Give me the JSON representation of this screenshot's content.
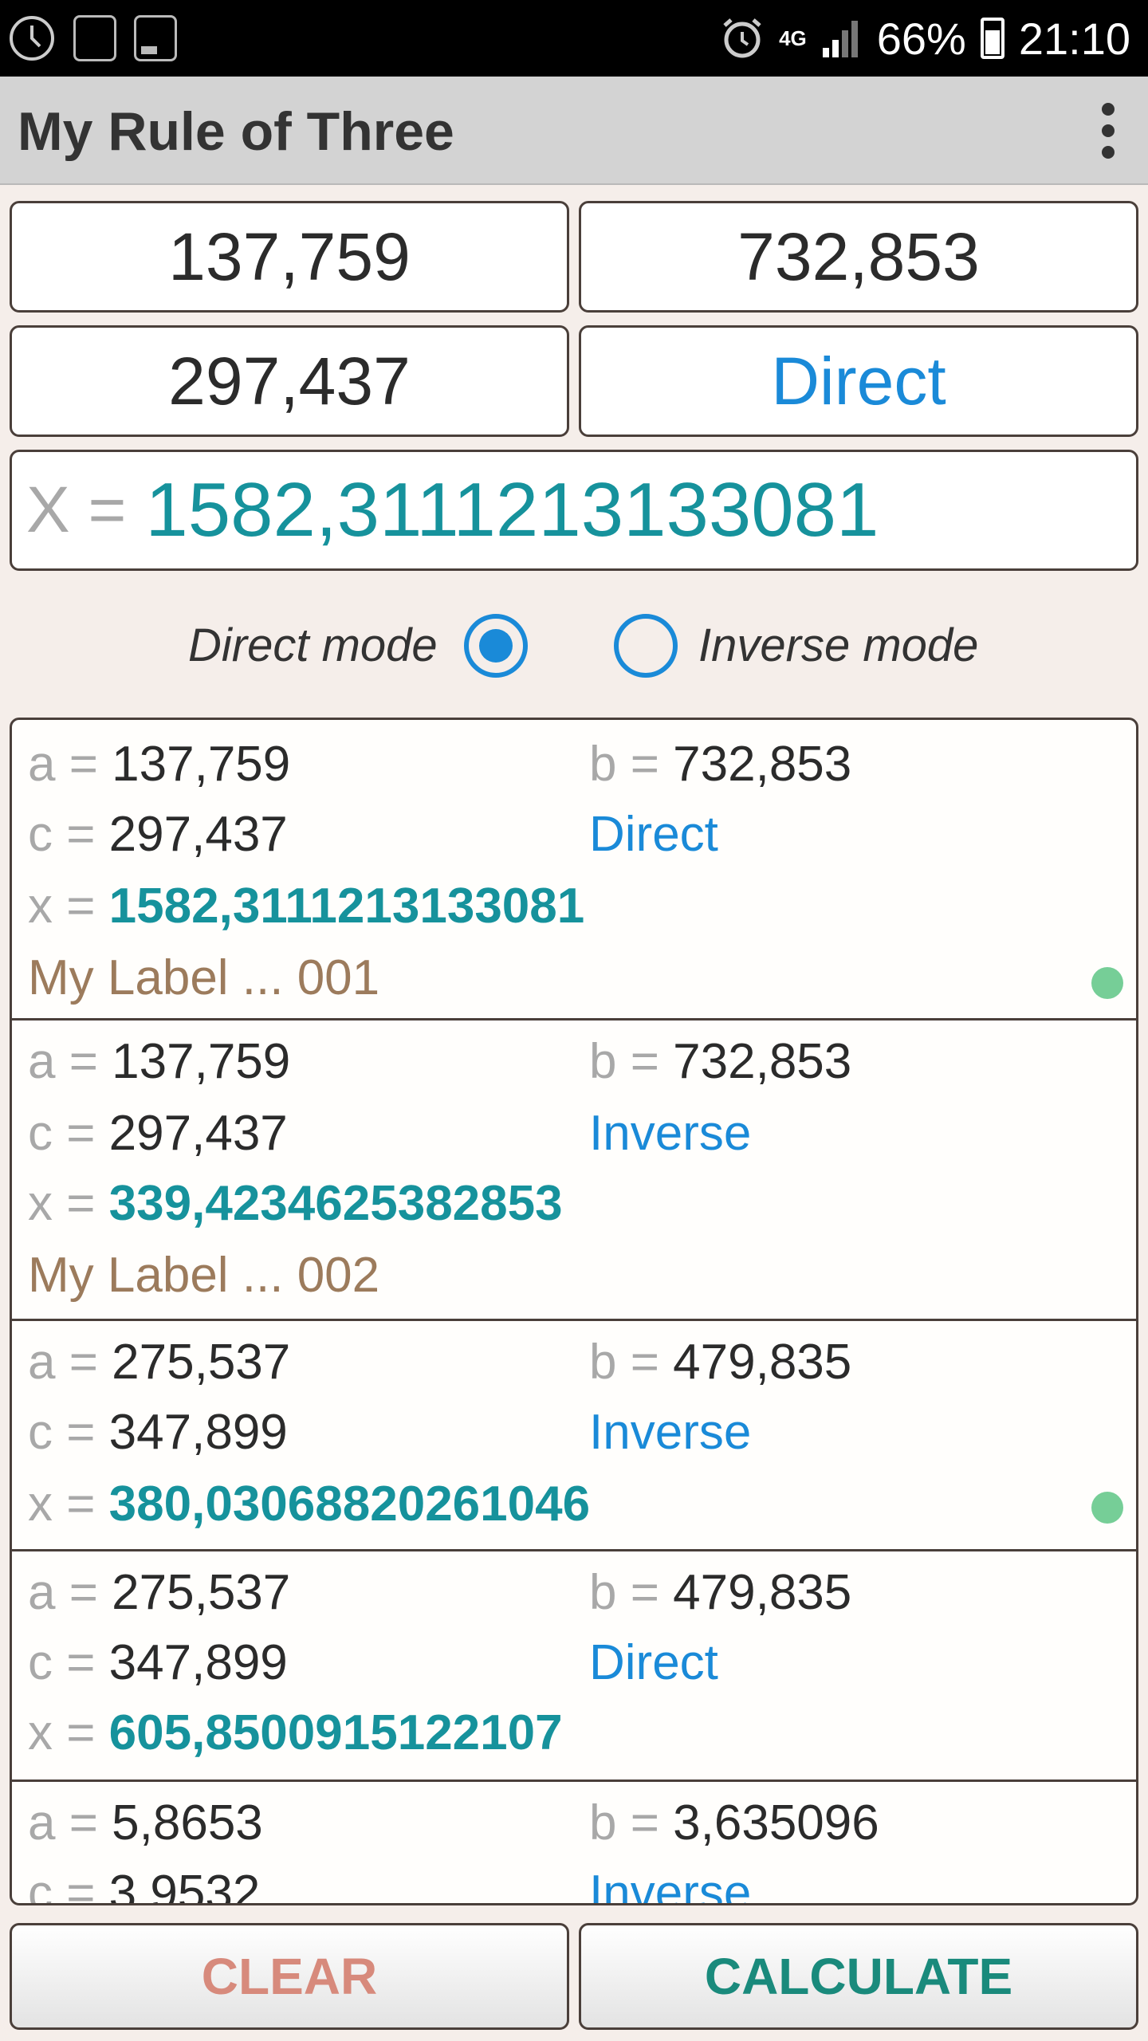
{
  "status_bar": {
    "battery": "66%",
    "time": "21:10",
    "network": "4G"
  },
  "app": {
    "title": "My Rule of Three"
  },
  "inputs": {
    "a": "137,759",
    "b": "732,853",
    "c": "297,437",
    "mode": "Direct"
  },
  "result": {
    "label": "X =",
    "value": "1582,3111213133081"
  },
  "modes": {
    "direct_label": "Direct mode",
    "inverse_label": "Inverse mode",
    "selected": "direct"
  },
  "history": [
    {
      "a_key": "a =",
      "a": "137,759",
      "b_key": "b =",
      "b": "732,853",
      "c_key": "c =",
      "c": "297,437",
      "mode": "Direct",
      "x_key": "x =",
      "x": "1582,3111213133081",
      "label": "My Label ... 001",
      "marked": true
    },
    {
      "a_key": "a =",
      "a": "137,759",
      "b_key": "b =",
      "b": "732,853",
      "c_key": "c =",
      "c": "297,437",
      "mode": "Inverse",
      "x_key": "x =",
      "x": "339,4234625382853",
      "label": "My Label ... 002",
      "marked": false
    },
    {
      "a_key": "a =",
      "a": "275,537",
      "b_key": "b =",
      "b": "479,835",
      "c_key": "c =",
      "c": "347,899",
      "mode": "Inverse",
      "x_key": "x =",
      "x": "380,03068820261046",
      "marked": true
    },
    {
      "a_key": "a =",
      "a": "275,537",
      "b_key": "b =",
      "b": "479,835",
      "c_key": "c =",
      "c": "347,899",
      "mode": "Direct",
      "x_key": "x =",
      "x": "605,8500915122107",
      "marked": false
    },
    {
      "a_key": "a =",
      "a": "5,8653",
      "b_key": "b =",
      "b": "3,635096",
      "c_key": "c =",
      "c": "3,9532",
      "mode": "Inverse"
    }
  ],
  "buttons": {
    "clear": "CLEAR",
    "calculate": "CALCULATE"
  },
  "colors": {
    "accent_blue": "#1a8ad8",
    "result_teal": "#16929c",
    "label_brown": "#9c7b5c",
    "marker_green": "#76ce97",
    "clear_red": "#d78a7c",
    "calculate_teal": "#1a8a7c"
  }
}
